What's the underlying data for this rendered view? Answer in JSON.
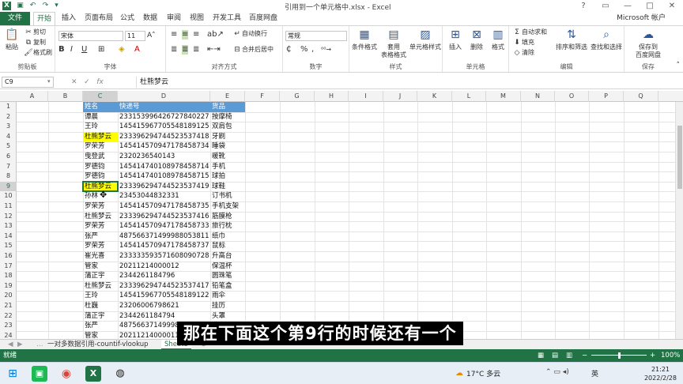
{
  "window": {
    "title": "引用到一个单元格中.xlsx - Excel",
    "controls": [
      "?",
      "▭",
      "—",
      "□",
      "✕"
    ]
  },
  "ribbon_tabs": [
    "文件",
    "开始",
    "插入",
    "页面布局",
    "公式",
    "数据",
    "审阅",
    "视图",
    "开发工具",
    "百度网盘"
  ],
  "account": "Microsoft 帐户",
  "ribbon": {
    "clipboard": {
      "label": "剪贴板",
      "paste": "粘贴",
      "cut": "剪切",
      "copy": "复制",
      "painter": "格式刷"
    },
    "font": {
      "label": "字体",
      "name": "宋体",
      "size": "11",
      "bold": "B",
      "italic": "I",
      "underline": "U"
    },
    "alignment": {
      "label": "对齐方式",
      "wrap": "自动换行",
      "merge": "合并后居中"
    },
    "number": {
      "label": "数字",
      "format": "常规",
      "percent": "%",
      "comma": ","
    },
    "styles": {
      "label": "样式",
      "conditional": "条件格式",
      "table": "套用\n表格格式",
      "cell_styles": "单元格样式"
    },
    "cells": {
      "label": "单元格",
      "insert": "插入",
      "delete": "删除",
      "format": "格式"
    },
    "editing": {
      "label": "编辑",
      "autosum": "自动求和",
      "fill": "填充",
      "clear": "清除",
      "sort": "排序和筛选",
      "find": "查找和选择"
    },
    "save": {
      "label": "保存",
      "baidu": "保存到\n百度网盘"
    }
  },
  "formula_bar": {
    "name_box": "C9",
    "fx": "fx",
    "content": "杜熊梦云"
  },
  "columns": [
    "A",
    "B",
    "C",
    "D",
    "E",
    "F",
    "G",
    "H",
    "I",
    "J",
    "K",
    "L",
    "M",
    "N",
    "O",
    "P",
    "Q"
  ],
  "row_numbers": [
    "1",
    "2",
    "3",
    "4",
    "5",
    "6",
    "7",
    "8",
    "9",
    "10",
    "11",
    "12",
    "13",
    "14",
    "15",
    "16",
    "17",
    "18",
    "19",
    "20",
    "21",
    "22",
    "23",
    "24"
  ],
  "table": {
    "headers": [
      "姓名",
      "快递号",
      "货品"
    ],
    "rows": [
      [
        "谭晨",
        "233153996426727840227",
        "按摩椅"
      ],
      [
        "王玲",
        "145415967705548189125",
        "双肩包"
      ],
      [
        "杜熊梦云",
        "233396294744523537418",
        "牙刷"
      ],
      [
        "罗荣芳",
        "145414570947178458734",
        "睡袋"
      ],
      [
        "曳登武",
        "2320236540143",
        "暖靴"
      ],
      [
        "罗德钧",
        "145414740108978458714",
        "手机"
      ],
      [
        "罗德钧",
        "145414740108978458715",
        "球拍"
      ],
      [
        "杜熊梦云",
        "233396294744523537419",
        "球鞋"
      ],
      [
        "孙林",
        "23453044832331",
        "订书机"
      ],
      [
        "罗荣芳",
        "145414570947178458735",
        "手机支架"
      ],
      [
        "杜熊梦云",
        "233396294744523537416",
        "筋膜枪"
      ],
      [
        "罗荣芳",
        "145414570947178458733",
        "旅行枕"
      ],
      [
        "张严",
        "487566371499988053811",
        "纸巾"
      ],
      [
        "罗荣芳",
        "145414570947178458737",
        "鼠标"
      ],
      [
        "崔光喜",
        "233333593571608090728",
        "升高台"
      ],
      [
        "管家",
        "20211214000012",
        "保温杯"
      ],
      [
        "蒲正宇",
        "2344261184796",
        "圆珠笔"
      ],
      [
        "杜熊梦云",
        "233396294744523537417",
        "铅笔盒"
      ],
      [
        "王玲",
        "145415967705548189122",
        "雨伞"
      ],
      [
        "杜巍",
        "23206006798621",
        "挂历"
      ],
      [
        "蒲正宇",
        "2344261184794",
        "头罩"
      ],
      [
        "张严",
        "487566371499988053811",
        ""
      ],
      [
        "管家",
        "20211214000011",
        ""
      ]
    ],
    "highlighted_rows": [
      3,
      8
    ]
  },
  "sheets": [
    "一对多数据引用-countif-vlookup",
    "Sheet3"
  ],
  "active_sheet": "Sheet3",
  "status": {
    "ready": "就绪",
    "zoom": "100%"
  },
  "subtitle": "那在下面这个第9行的时候还有一个",
  "taskbar": {
    "weather": "17°C 多云",
    "time": "21:21",
    "date": "2022/2/28",
    "lang": "英"
  },
  "colors": {
    "excel_green": "#217346",
    "header_blue": "#5b9bd5",
    "highlight_yellow": "#ffff00"
  }
}
